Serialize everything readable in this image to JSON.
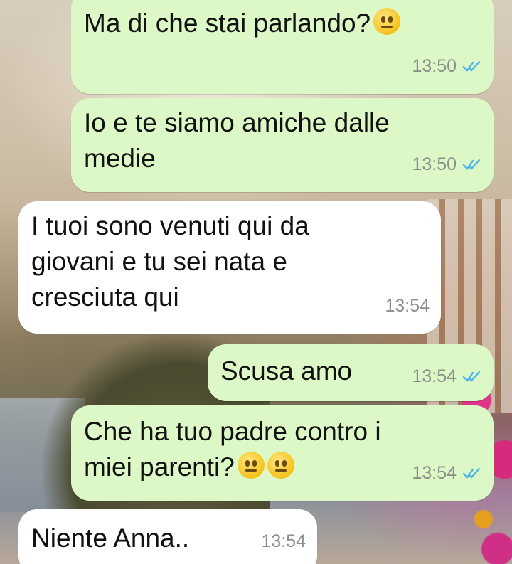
{
  "messages": [
    {
      "direction": "outgoing",
      "text": "Ma di che stai parlando?",
      "emojis": [
        "neutral-face"
      ],
      "time": "13:50",
      "status": "read"
    },
    {
      "direction": "outgoing",
      "text": "Io e te siamo amiche dalle\nmedie",
      "emojis": [],
      "time": "13:50",
      "status": "read"
    },
    {
      "direction": "incoming",
      "text": "I tuoi sono venuti qui da\ngiovani e tu sei nata e\ncresciuta qui",
      "emojis": [],
      "time": "13:54"
    },
    {
      "direction": "outgoing",
      "text": "Scusa amo",
      "emojis": [],
      "time": "13:54",
      "status": "read"
    },
    {
      "direction": "outgoing",
      "text": "Che ha tuo padre contro i\nmiei parenti?",
      "emojis": [
        "neutral-face",
        "neutral-face"
      ],
      "time": "13:54",
      "status": "read"
    },
    {
      "direction": "incoming",
      "text": "Niente Anna..",
      "emojis": [],
      "time": "13:54"
    }
  ],
  "colors": {
    "outgoing_bubble": "#dcf8c6",
    "incoming_bubble": "#ffffff",
    "read_ticks": "#4fb6ec",
    "timestamp": "#8a8f8a"
  }
}
